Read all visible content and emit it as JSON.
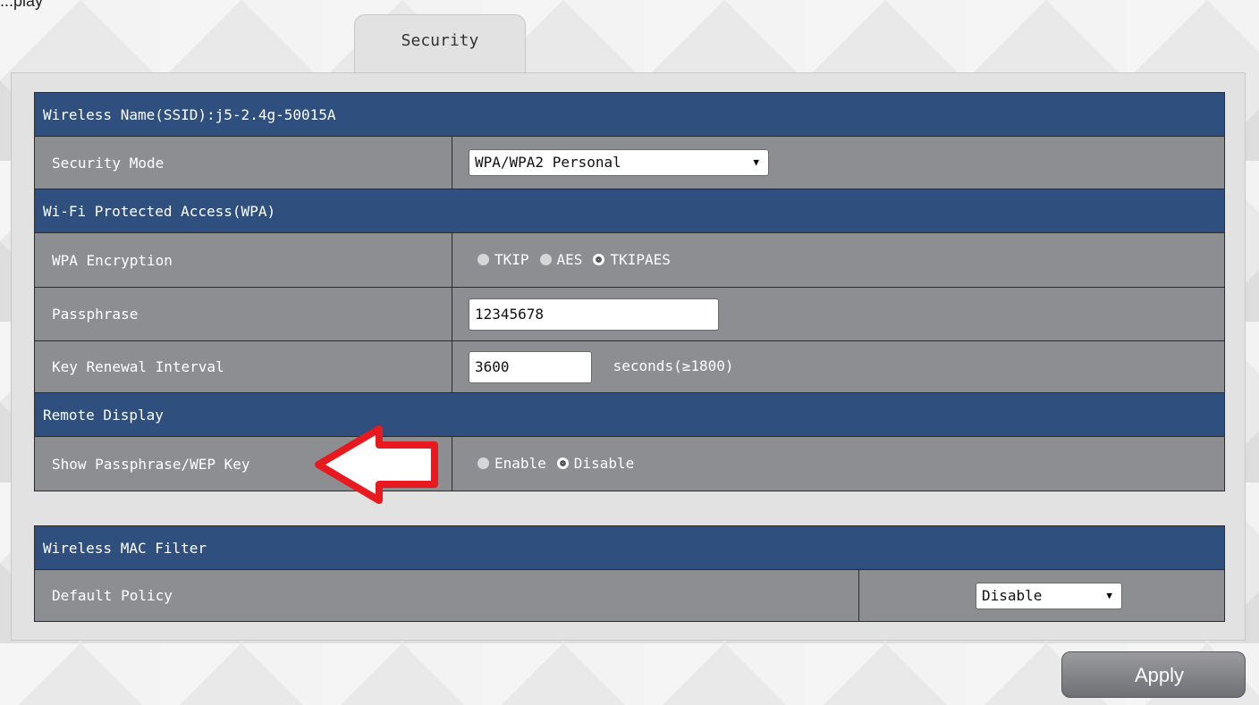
{
  "top_text": "...play",
  "tab": {
    "label": "Security"
  },
  "ssid_header": "Wireless Name(SSID):j5-2.4g-50015A",
  "security_mode": {
    "label": "Security Mode",
    "value": "WPA/WPA2 Personal"
  },
  "wpa_header": "Wi-Fi Protected Access(WPA)",
  "wpa_encryption": {
    "label": "WPA Encryption",
    "options": [
      "TKIP",
      "AES",
      "TKIPAES"
    ],
    "selected": "TKIPAES"
  },
  "passphrase": {
    "label": "Passphrase",
    "value": "12345678"
  },
  "key_renewal": {
    "label": "Key Renewal Interval",
    "value": "3600",
    "suffix": "seconds(≥1800)"
  },
  "remote_header": "Remote Display",
  "show_passphrase": {
    "label": "Show Passphrase/WEP Key",
    "options": [
      "Enable",
      "Disable"
    ],
    "selected": "Disable"
  },
  "mac_header": "Wireless MAC Filter",
  "default_policy": {
    "label": "Default Policy",
    "value": "Disable"
  },
  "apply_label": "Apply",
  "colors": {
    "header_bg": "#2f4f7e",
    "row_bg": "#8d8e92",
    "annotation_arrow": "#e8191f"
  },
  "icons": {
    "annotation": "red-arrow-icon",
    "dropdown": "chevron-down-icon"
  }
}
